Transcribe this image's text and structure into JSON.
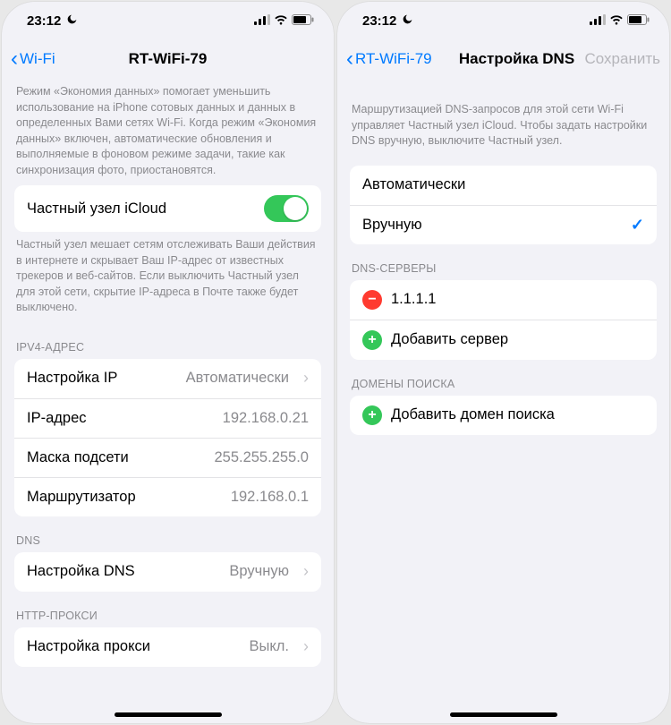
{
  "status": {
    "time": "23:12"
  },
  "left": {
    "back": "Wi-Fi",
    "title": "RT-WiFi-79",
    "data_saver_note": "Режим «Экономия данных» помогает уменьшить использование на iPhone сотовых данных и данных в определенных Вами сетях Wi-Fi. Когда режим «Экономия данных» включен, автоматические обновления и выполняемые в фоновом режиме задачи, такие как синхронизация фото, приостановятся.",
    "private_relay": {
      "label": "Частный узел iCloud"
    },
    "private_relay_note": "Частный узел мешает сетям отслеживать Ваши действия в интернете и скрывает Ваш IP-адрес от известных трекеров и веб-сайтов. Если выключить Частный узел для этой сети, скрытие IP-адреса в Почте также будет выключено.",
    "ipv4_header": "IPV4-АДРЕС",
    "ipv4": {
      "configure_label": "Настройка IP",
      "configure_value": "Автоматически",
      "ip_label": "IP-адрес",
      "ip_value": "192.168.0.21",
      "mask_label": "Маска подсети",
      "mask_value": "255.255.255.0",
      "router_label": "Маршрутизатор",
      "router_value": "192.168.0.1"
    },
    "dns_header": "DNS",
    "dns": {
      "configure_label": "Настройка DNS",
      "configure_value": "Вручную"
    },
    "proxy_header": "HTTP-ПРОКСИ",
    "proxy": {
      "configure_label": "Настройка прокси",
      "configure_value": "Выкл."
    }
  },
  "right": {
    "back": "RT-WiFi-79",
    "title": "Настройка DNS",
    "save": "Сохранить",
    "note": "Маршрутизацией DNS-запросов для этой сети Wi-Fi управляет Частный узел iCloud. Чтобы задать настройки DNS вручную, выключите Частный узел.",
    "mode": {
      "auto": "Автоматически",
      "manual": "Вручную"
    },
    "servers_header": "DNS-СЕРВЕРЫ",
    "servers": {
      "entry0": "1.1.1.1",
      "add": "Добавить сервер"
    },
    "domains_header": "ДОМЕНЫ ПОИСКА",
    "domains": {
      "add": "Добавить домен поиска"
    }
  }
}
